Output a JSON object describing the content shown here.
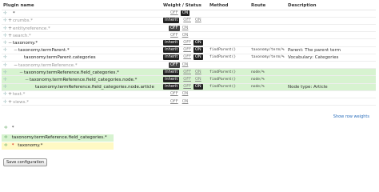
{
  "headers": {
    "plugin_name": "Plugin name",
    "weight_status": "Weight / Status",
    "method": "Method",
    "route": "Route",
    "description": "Description"
  },
  "rows": [
    {
      "name": "*",
      "indent": 0,
      "toggle": "",
      "weight": "",
      "off": "OFF",
      "on": "ON",
      "off_active": false,
      "on_active": true,
      "method": "",
      "route": "",
      "description": "",
      "muted": false,
      "green": false
    },
    {
      "name": "crumbs.*",
      "indent": 0,
      "toggle": "+",
      "weight": "Inherit",
      "off": "OFF",
      "on": "ON",
      "off_active": false,
      "on_active": false,
      "method": "",
      "route": "",
      "description": "",
      "muted": true,
      "green": false
    },
    {
      "name": "entityreference.*",
      "indent": 0,
      "toggle": "+",
      "weight": "",
      "off": "OFF",
      "on": "ON",
      "off_active": true,
      "on_active": false,
      "method": "",
      "route": "",
      "description": "",
      "muted": true,
      "green": false
    },
    {
      "name": "search.*",
      "indent": 0,
      "toggle": "+",
      "weight": "",
      "off": "OFF",
      "on": "ON",
      "off_active": false,
      "on_active": false,
      "method": "",
      "route": "",
      "description": "",
      "muted": true,
      "green": false
    },
    {
      "name": "taxonomy.*",
      "indent": 0,
      "toggle": "−",
      "weight": "Inherit",
      "off": "OFF",
      "on": "ON",
      "off_active": false,
      "on_active": true,
      "method": "",
      "route": "",
      "description": "",
      "muted": false,
      "green": false
    },
    {
      "name": "taxonomy.termParent.*",
      "indent": 1,
      "toggle": "−",
      "weight": "Inherit",
      "off": "OFF",
      "on": "ON",
      "off_active": false,
      "on_active": true,
      "method": "findParent()",
      "route": "taxonomy/term/%",
      "description": "Parent: The parent term",
      "muted": false,
      "green": false
    },
    {
      "name": "taxonomy.termParent.categories",
      "indent": 2,
      "toggle": "",
      "weight": "Inherit",
      "off": "OFF",
      "on": "ON",
      "off_active": false,
      "on_active": true,
      "method": "findParent()",
      "route": "taxonomy/term/%",
      "description": "Vocabulary: Categories",
      "muted": false,
      "green": false
    },
    {
      "name": "taxonomy.termReference.*",
      "indent": 1,
      "toggle": "−",
      "weight": "",
      "off": "OFF",
      "on": "ON",
      "off_active": true,
      "on_active": false,
      "method": "",
      "route": "",
      "description": "",
      "muted": true,
      "green": false
    },
    {
      "name": "taxonomy.termReference.field_categories.*",
      "indent": 2,
      "toggle": "−",
      "weight": "Inherit",
      "off": "OFF",
      "on": "ON",
      "off_active": false,
      "on_active": false,
      "method": "findParent()",
      "route": "node/%",
      "description": "",
      "muted": false,
      "green": true
    },
    {
      "name": "taxonomy.termReference.field_categories.node.*",
      "indent": 3,
      "toggle": "−",
      "weight": "Inherit",
      "off": "OFF",
      "on": "ON",
      "off_active": false,
      "on_active": false,
      "method": "findParent()",
      "route": "node/%",
      "description": "",
      "muted": false,
      "green": true
    },
    {
      "name": "taxonomy.termReference.field_categories.node.article",
      "indent": 4,
      "toggle": "",
      "weight": "Inherit",
      "off": "OFF",
      "on": "ON",
      "off_active": false,
      "on_active": true,
      "method": "findParent()",
      "route": "node/%",
      "description": "Node type: Article",
      "muted": false,
      "green": true
    },
    {
      "name": "text.*",
      "indent": 0,
      "toggle": "+",
      "weight": "",
      "off": "OFF",
      "on": "ON",
      "off_active": false,
      "on_active": false,
      "method": "",
      "route": "",
      "description": "",
      "muted": true,
      "green": false
    },
    {
      "name": "views.*",
      "indent": 0,
      "toggle": "+",
      "weight": "",
      "off": "OFF",
      "on": "ON",
      "off_active": false,
      "on_active": false,
      "method": "",
      "route": "",
      "description": "",
      "muted": true,
      "green": false
    }
  ],
  "show_row_weights": "Show row weights",
  "bottom_list": [
    {
      "name": "*",
      "star": false,
      "style": "plain"
    },
    {
      "name": "taxonomy.termReference.field_categories.*",
      "star": false,
      "style": "green"
    },
    {
      "name": "taxonomy.*",
      "star": true,
      "style": "yellow"
    }
  ],
  "save_label": "Save configuration"
}
